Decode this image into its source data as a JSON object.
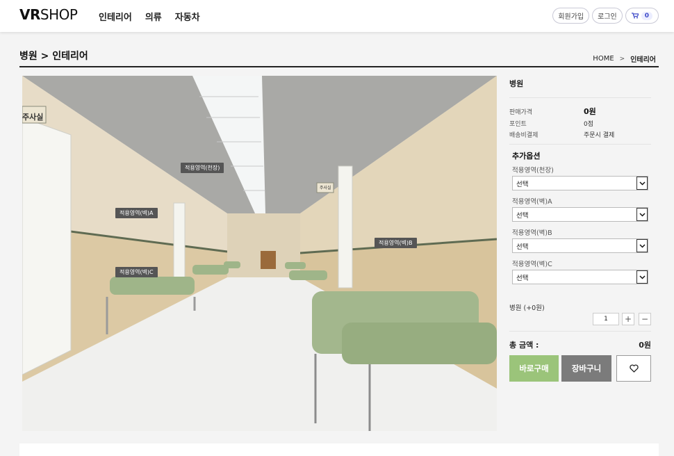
{
  "header": {
    "logo_bold": "VR",
    "logo_light": "SHOP",
    "nav": [
      "인테리어",
      "의류",
      "자동차"
    ],
    "signup": "회원가입",
    "login": "로그인",
    "cart_count": "0",
    "cart_icon": "cart-icon"
  },
  "page": {
    "title": "병원 > 인테리어",
    "breadcrumb": [
      "HOME",
      ">",
      "인테리어"
    ]
  },
  "image": {
    "sign_room": "주사실",
    "sign_room_small": "주사실",
    "tags": [
      "적용영역(천장)",
      "적용영역(벽)A",
      "적용영역(벽)B",
      "적용영역(벽)C"
    ]
  },
  "product": {
    "name": "병원",
    "price_label": "판매가격",
    "price_value": "0원",
    "point_label": "포인트",
    "point_value": "0점",
    "shipping_label": "배송비결제",
    "shipping_value": "주문시 결제",
    "options_title": "추가옵션",
    "options": [
      {
        "label": "적용영역(천장)",
        "selected": "선택"
      },
      {
        "label": "적용영역(벽)A",
        "selected": "선택"
      },
      {
        "label": "적용영역(벽)B",
        "selected": "선택"
      },
      {
        "label": "적용영역(벽)C",
        "selected": "선택"
      }
    ],
    "qty_label": "병원 (+0원)",
    "qty_value": "1",
    "plus": "+",
    "minus": "−",
    "total_label": "총 금액 :",
    "total_value": "0원",
    "buy_now": "바로구매",
    "add_cart": "장바구니",
    "wish_icon": "heart-icon"
  },
  "colors": {
    "buy_btn": "#9bc47a",
    "cart_btn": "#7b7b7b",
    "wall": "#e2d6bf",
    "bench": "#9fb589"
  }
}
